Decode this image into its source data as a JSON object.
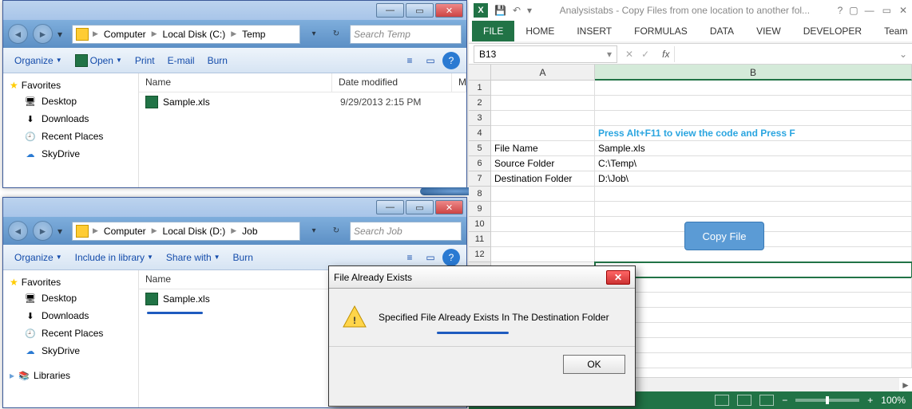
{
  "explorer1": {
    "breadcrumb": [
      "Computer",
      "Local Disk (C:)",
      "Temp"
    ],
    "search_placeholder": "Search Temp",
    "toolbar": {
      "organize": "Organize",
      "open": "Open",
      "print": "Print",
      "email": "E-mail",
      "burn": "Burn"
    },
    "favorites_label": "Favorites",
    "favorites": [
      "Desktop",
      "Downloads",
      "Recent Places",
      "SkyDrive"
    ],
    "columns": {
      "name": "Name",
      "date": "Date modified",
      "third": "M"
    },
    "file": {
      "name": "Sample.xls",
      "date": "9/29/2013 2:15 PM"
    }
  },
  "explorer2": {
    "breadcrumb": [
      "Computer",
      "Local Disk (D:)",
      "Job"
    ],
    "search_placeholder": "Search Job",
    "toolbar": {
      "organize": "Organize",
      "include": "Include in library",
      "share": "Share with",
      "burn": "Burn"
    },
    "favorites_label": "Favorites",
    "favorites": [
      "Desktop",
      "Downloads",
      "Recent Places",
      "SkyDrive"
    ],
    "libraries_label": "Libraries",
    "columns": {
      "name": "Name"
    },
    "file": {
      "name": "Sample.xls"
    }
  },
  "dialog": {
    "title": "File Already Exists",
    "message": "Specified File Already Exists In The Destination Folder",
    "ok": "OK"
  },
  "excel": {
    "title": "Analysistabs - Copy Files from one location to another fol...",
    "tabs": [
      "FILE",
      "HOME",
      "INSERT",
      "FORMULAS",
      "DATA",
      "VIEW",
      "DEVELOPER",
      "Team"
    ],
    "namebox": "B13",
    "fx": "fx",
    "col_A": "A",
    "col_B": "B",
    "row4_msg": "Press Alt+F11 to view the code and Press F",
    "rows": {
      "5": {
        "A": "File Name",
        "B": "Sample.xls"
      },
      "6": {
        "A": "Source Folder",
        "B": "C:\\Temp\\"
      },
      "7": {
        "A": "Destination Folder",
        "B": "D:\\Job\\"
      }
    },
    "button": "Copy File",
    "zoom": "100%"
  }
}
